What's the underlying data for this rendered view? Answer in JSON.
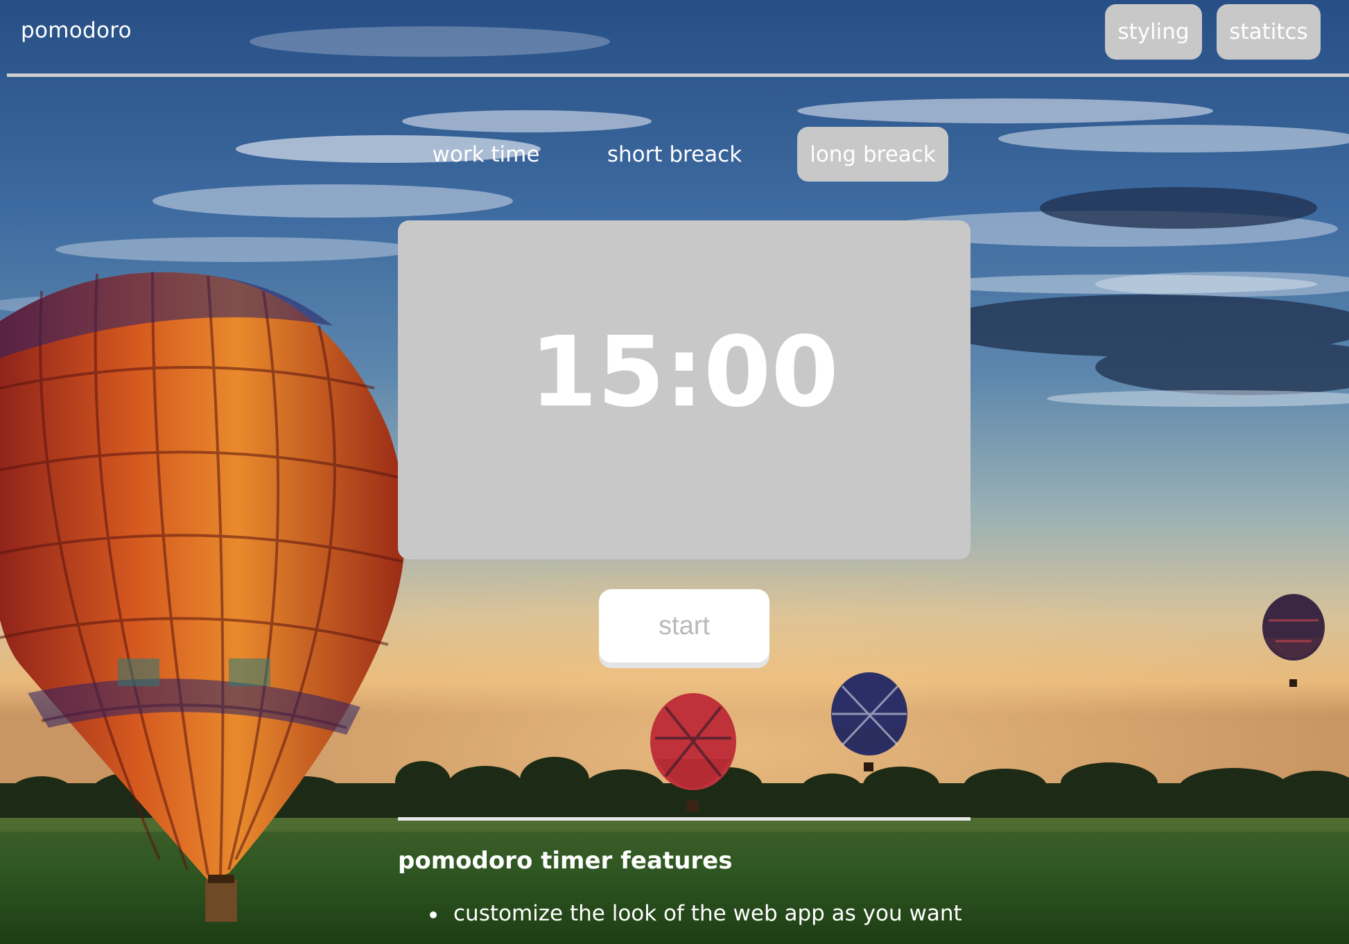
{
  "header": {
    "brand": "pomodoro",
    "styling_label": "styling",
    "statistics_label": "statitcs"
  },
  "modes": {
    "work": "work time",
    "short": "short breack",
    "long": "long breack",
    "active": "long"
  },
  "timer": {
    "display": "15:00"
  },
  "controls": {
    "start_label": "start"
  },
  "features": {
    "title": "pomodoro timer features",
    "items": [
      "customize the look of the web app as you want"
    ]
  },
  "colors": {
    "button_bg": "#c8c8c8",
    "text": "#ffffff",
    "start_text": "#b9b9b9"
  }
}
